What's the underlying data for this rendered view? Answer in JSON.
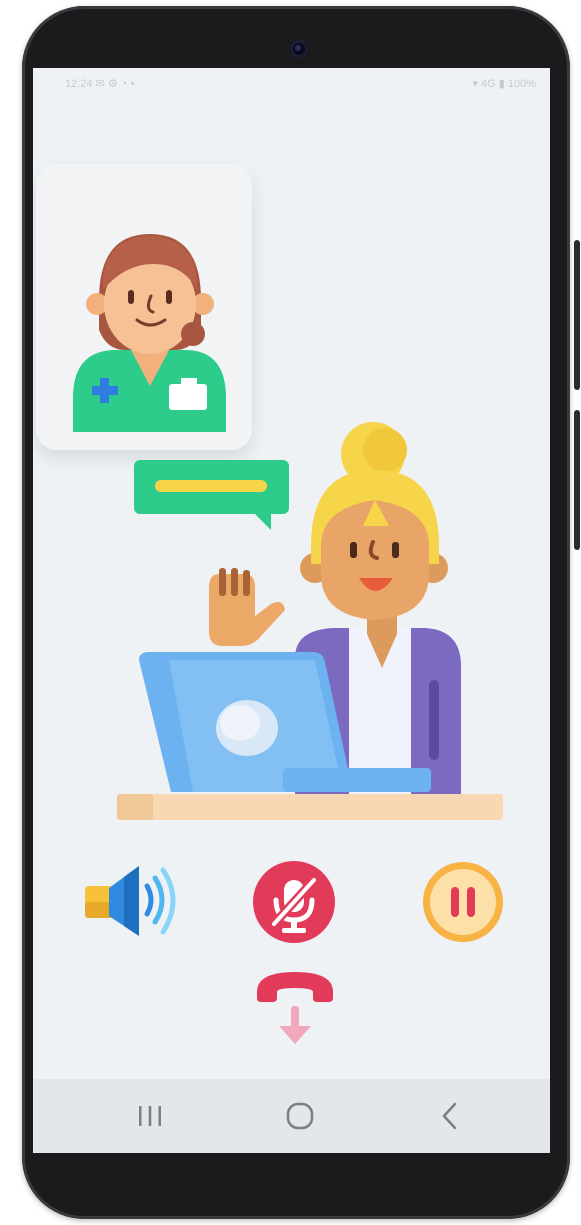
{
  "status_bar": {
    "left_text": "12:24 ✉ ⚙ ◔ •",
    "right_text": "▾ 4G ▮ 100%"
  },
  "call_screen": {
    "caller_icon": "nurse-avatar-icon",
    "callee_icon": "woman-with-laptop-icon",
    "chat_icon": "speech-bubble-icon"
  },
  "controls": {
    "speaker": {
      "icon": "speaker-volume-icon",
      "color": "#1f7fd8"
    },
    "mute": {
      "icon": "microphone-muted-icon",
      "color": "#e23b5a"
    },
    "hold": {
      "icon": "pause-icon",
      "color": "#f7b343"
    },
    "end_call": {
      "icon": "hang-up-phone-icon",
      "color": "#e23b5a"
    }
  },
  "nav_bar": {
    "recents": "|||",
    "home": "◯",
    "back": "<"
  },
  "colors": {
    "screen_bg": "#eef2f5",
    "scrub_green": "#2ecc8b",
    "laptop_blue": "#6cb2f0",
    "hair_yellow": "#f7d54a"
  }
}
